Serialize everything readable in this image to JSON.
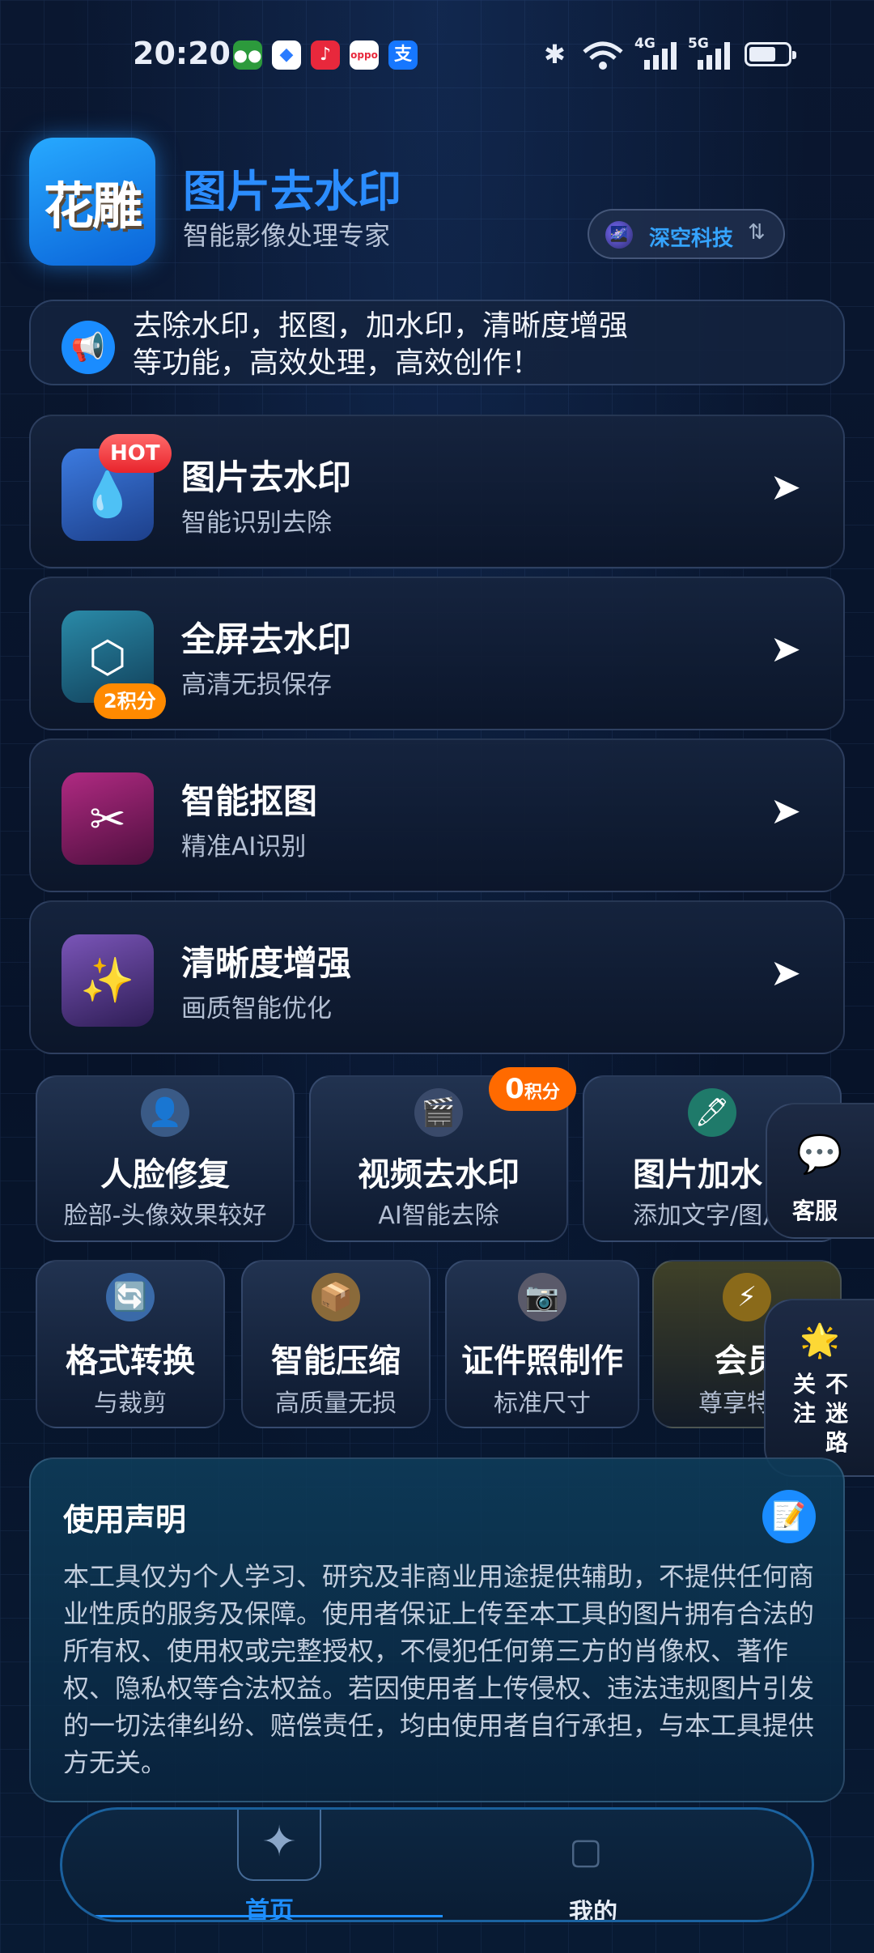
{
  "status_bar": {
    "time": "20:20",
    "apps": [
      "wechat-icon",
      "browser-icon",
      "music-icon",
      "oppo-icon",
      "alipay-icon"
    ],
    "oppo_label": "oppo",
    "alipay_label": "支",
    "signal_4g": "4G",
    "signal_5g": "5G",
    "battery_level": 0.7
  },
  "header": {
    "logo_text": "花雕",
    "title": "图片去水印",
    "subtitle": "智能影像处理专家",
    "brand": "深空科技",
    "brand_switch": "⇅"
  },
  "notice": {
    "text": "去除水印，抠图，加水印，清晰度增强等功能，高效处理，高效创作！"
  },
  "features": [
    {
      "title": "图片去水印",
      "subtitle": "智能识别去除",
      "badge": "HOT",
      "icon": "water-drop-icon",
      "color": "#2b64c8"
    },
    {
      "title": "全屏去水印",
      "subtitle": "高清无损保存",
      "badge": "2积分",
      "icon": "hexagon-icon",
      "color": "#1b6b86"
    },
    {
      "title": "智能抠图",
      "subtitle": "精准AI识别",
      "badge": "",
      "icon": "scissors-icon",
      "color": "#8a1c6a"
    },
    {
      "title": "清晰度增强",
      "subtitle": "画质智能优化",
      "badge": "",
      "icon": "sparkles-icon",
      "color": "#5a3a8c"
    }
  ],
  "tiles_row1": [
    {
      "title": "人脸修复",
      "subtitle": "脸部-头像效果较好",
      "icon": "user-icon"
    },
    {
      "title": "视频去水印",
      "subtitle": "AI智能去除",
      "icon": "film-icon"
    },
    {
      "title": "图片加水",
      "subtitle": "添加文字/图片",
      "icon": "pen-icon"
    }
  ],
  "points_badge": {
    "value": "0",
    "unit": "积分"
  },
  "tiles_row2": [
    {
      "title": "格式转换",
      "subtitle": "与裁剪",
      "icon": "convert-icon"
    },
    {
      "title": "智能压缩",
      "subtitle": "高质量无损",
      "icon": "box-icon"
    },
    {
      "title": "证件照制作",
      "subtitle": "标准尺寸",
      "icon": "camera-icon"
    },
    {
      "title": "会员",
      "subtitle": "尊享特权",
      "icon": "lightning-icon"
    }
  ],
  "float_service": {
    "label": "客服"
  },
  "float_follow": {
    "c1": "关",
    "c2": "注",
    "c3": "不",
    "c4": "迷",
    "c5": "路"
  },
  "statement": {
    "title": "使用声明",
    "body": "本工具仅为个人学习、研究及非商业用途提供辅助，不提供任何商业性质的服务及保障。使用者保证上传至本工具的图片拥有合法的所有权、使用权或完整授权，不侵犯任何第三方的肖像权、著作权、隐私权等合法权益。若因使用者上传侵权、违法违规图片引发的一切法律纠纷、赔偿责任，均由使用者自行承担，与本工具提供方无关。"
  },
  "nav": {
    "home": "首页",
    "me": "我的"
  }
}
